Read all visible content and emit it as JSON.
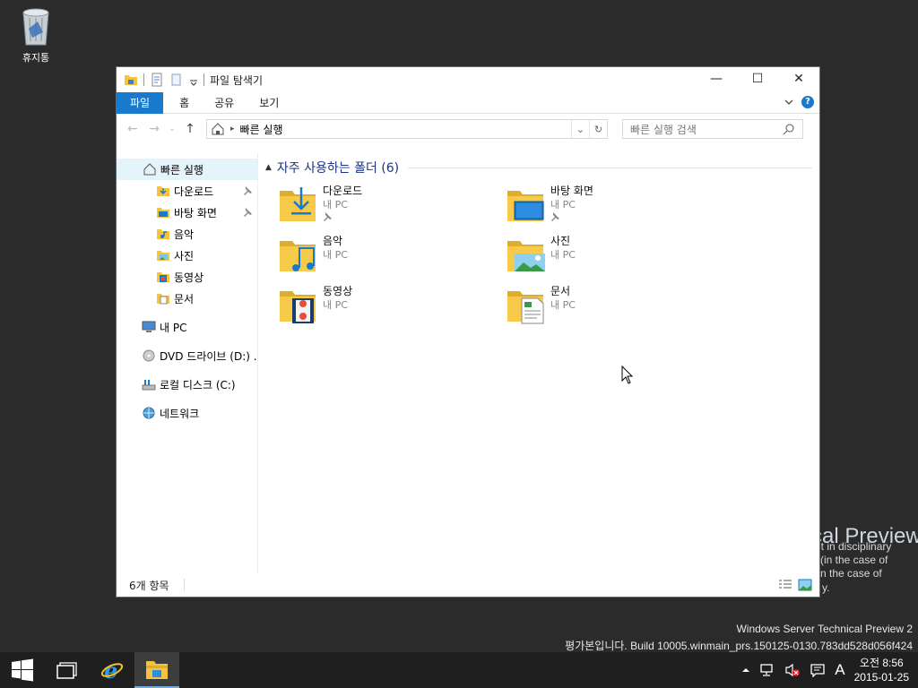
{
  "desktop": {
    "recycle_bin_label": "휴지통",
    "watermark": {
      "title_fragment": "cal Preview",
      "lines": [
        "lt in disciplinary",
        "(in the case of",
        "n the case of",
        "y."
      ],
      "product": "Windows Server Technical Preview 2",
      "build": "평가본입니다. Build 10005.winmain_prs.150125-0130.783dd528d056f424"
    }
  },
  "window": {
    "title": "파일 탐색기",
    "controls": {
      "minimize": "—",
      "maximize": "☐",
      "close": "✕"
    },
    "ribbon": {
      "tabs": [
        "파일",
        "홈",
        "공유",
        "보기"
      ],
      "help": "?"
    },
    "nav": {
      "address_crumb": "빠른 실행",
      "search_placeholder": "빠른 실행 검색"
    },
    "sidebar": {
      "quick_access": "빠른 실행",
      "pinned": [
        "다운로드",
        "바탕 화면",
        "음악",
        "사진",
        "동영상",
        "문서"
      ],
      "this_pc": "내 PC",
      "dvd": "DVD 드라이브 (D:) .",
      "local_disk": "로컬 디스크 (C:)",
      "network": "네트워크"
    },
    "main": {
      "group_title": "자주 사용하는 폴더 (6)",
      "folders": [
        {
          "name": "다운로드",
          "location": "내 PC",
          "pinned": true
        },
        {
          "name": "바탕 화면",
          "location": "내 PC",
          "pinned": true
        },
        {
          "name": "음악",
          "location": "내 PC",
          "pinned": false
        },
        {
          "name": "사진",
          "location": "내 PC",
          "pinned": false
        },
        {
          "name": "동영상",
          "location": "내 PC",
          "pinned": false
        },
        {
          "name": "문서",
          "location": "내 PC",
          "pinned": false
        }
      ]
    },
    "status": {
      "item_count": "6개 항목"
    }
  },
  "taskbar": {
    "ime": "A",
    "time": "오전 8:56",
    "date": "2015-01-25"
  }
}
